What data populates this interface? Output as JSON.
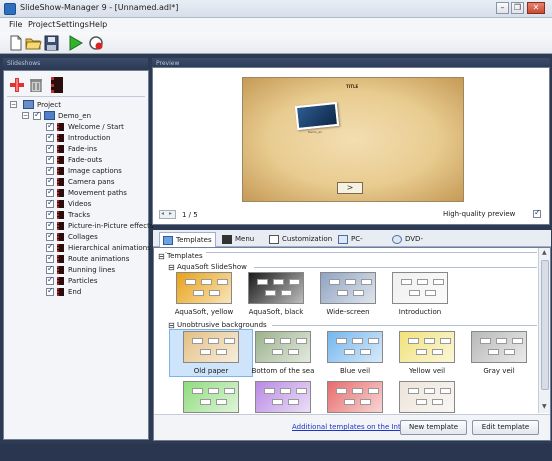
{
  "window": {
    "title": "SlideShow-Manager 9 - [Unnamed.adl*]",
    "minimize": "–",
    "restore": "❐",
    "close": "✕"
  },
  "menu": [
    "File",
    "Project",
    "Settings",
    "Help"
  ],
  "toolbar": [
    "new-file-icon",
    "open-folder-icon",
    "save-icon",
    "play-icon",
    "record-icon"
  ],
  "left_panel": {
    "header": "Slideshows",
    "toolbar": [
      "add-icon",
      "delete-icon",
      "film-icon"
    ],
    "tree_root": "Project",
    "tree_child": "Demo_en",
    "tree_items": [
      "Welcome / Start",
      "Introduction",
      "Fade-ins",
      "Fade-outs",
      "Image captions",
      "Camera pans",
      "Movement paths",
      "Videos",
      "Tracks",
      "Picture-in-Picture effects",
      "Collages",
      "Hierarchical animations",
      "Route animations",
      "Running lines",
      "Particles",
      "End"
    ]
  },
  "preview": {
    "header": "Preview",
    "page_indicator": "1 / 5",
    "hq_label": "High-quality preview",
    "hq_checked": true,
    "slide_title": "TITLE",
    "slide_caption": "Demo_en",
    "nav_arrow": ">"
  },
  "tabs": [
    {
      "label": "Templates",
      "active": true
    },
    {
      "label": "Menu",
      "active": false
    },
    {
      "label": "Customization",
      "active": false
    },
    {
      "label": "PC-Menu",
      "active": false
    },
    {
      "label": "DVD-Menu",
      "active": false
    }
  ],
  "gallery": {
    "root": "Templates",
    "group1": "AquaSoft SlideShow",
    "group1_items": [
      {
        "label": "AquaSoft, yellow",
        "color": "#e8a215"
      },
      {
        "label": "AquaSoft, black",
        "color": "#1a1a1a"
      },
      {
        "label": "Wide-screen",
        "color": "#8fa3c2"
      },
      {
        "label": "Introduction",
        "color": "#f0f0f0"
      }
    ],
    "group2": "Unobtrusive backgrounds",
    "group2_items": [
      {
        "label": "Old paper",
        "color": "#e3c084",
        "selected": true
      },
      {
        "label": "Bottom of the sea",
        "color": "#9bb28c"
      },
      {
        "label": "Blue veil",
        "color": "#74b6ee"
      },
      {
        "label": "Yellow veil",
        "color": "#f1e27a"
      },
      {
        "label": "Gray veil",
        "color": "#b8b8b8"
      }
    ],
    "row3_colors": [
      "#8fdc7d",
      "#b98ae4",
      "#e86c6c",
      "#ece4da"
    ],
    "link": "Additional templates on the Internet",
    "new_button": "New template",
    "edit_button": "Edit template"
  }
}
